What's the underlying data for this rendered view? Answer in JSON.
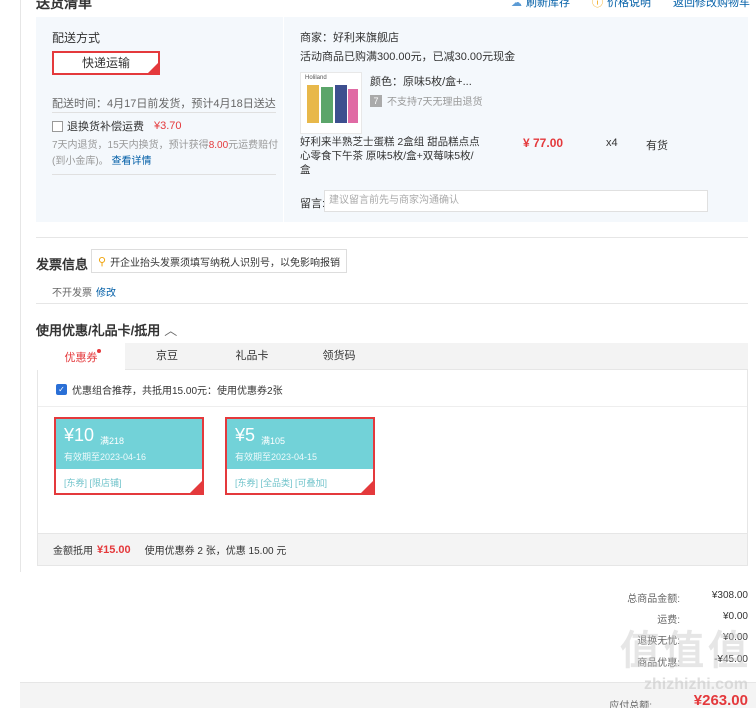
{
  "header": {
    "title": "送货清单",
    "links": [
      "刷新库存",
      "价格说明",
      "返回修改购物车"
    ]
  },
  "shipping": {
    "method_label": "配送方式",
    "method_value": "快递运输",
    "time": "配送时间：4月17日前发货，预计4月18日送达",
    "insurance_label": "退换货补偿运费",
    "insurance_price": "¥3.70",
    "insurance_desc_a": "7天内退货，15天内换货，预计获得",
    "insurance_desc_hl": "8.00",
    "insurance_desc_b": "元运费赔付(到小金库)。",
    "insurance_link": "查看详情"
  },
  "shop": {
    "name": "商家：好利来旗舰店",
    "promo": "活动商品已购满300.00元，已减30.00元现金",
    "thumb_brand": "Holiland",
    "color": "颜色：原味5枚/盒+...",
    "no_return": "不支持7天无理由退货",
    "product_name": "好利来半熟芝士蛋糕 2盒组 甜品糕点点心零食下午茶 原味5枚/盒+双莓味5枚/盒",
    "price": "¥ 77.00",
    "qty": "x4",
    "stock": "有货",
    "memo_label": "留言:",
    "memo_placeholder": "建议留言前先与商家沟通确认"
  },
  "invoice": {
    "title": "发票信息",
    "tip": "开企业抬头发票须填写纳税人识别号，以免影响报销",
    "status": "不开发票",
    "edit": "修改"
  },
  "coupons": {
    "title": "使用优惠/礼品卡/抵用",
    "tabs": [
      "优惠券",
      "京豆",
      "礼品卡",
      "领货码"
    ],
    "combo_text": "优惠组合推荐，共抵用15.00元：使用优惠券2张",
    "items": [
      {
        "amount": "¥10",
        "cond": "满218",
        "expiry": "有效期至2023-04-16",
        "tags": "[东券] [限店铺]"
      },
      {
        "amount": "¥5",
        "cond": "满105",
        "expiry": "有效期至2023-04-15",
        "tags": "[东券] [全品类] [可叠加]"
      }
    ],
    "footer_label": "金额抵用",
    "footer_amount": "¥15.00",
    "footer_desc": "使用优惠券 2 张，优惠 15.00 元"
  },
  "summary": {
    "rows": [
      {
        "k": "总商品金额:",
        "v": "¥308.00"
      },
      {
        "k": "运费:",
        "v": "¥0.00"
      },
      {
        "k": "退换无忧:",
        "v": "¥0.00"
      },
      {
        "k": "商品优惠:",
        "v": "-¥45.00"
      }
    ],
    "total_label": "应付总额:",
    "total_value": "¥263.00"
  },
  "watermark": {
    "a": "值值值",
    "b": "zhizhizhi.com"
  },
  "colors": {
    "accent": "#e4393c",
    "link": "#005ea7",
    "coupon": "#72d2d8",
    "panel": "#f4f8fc"
  }
}
